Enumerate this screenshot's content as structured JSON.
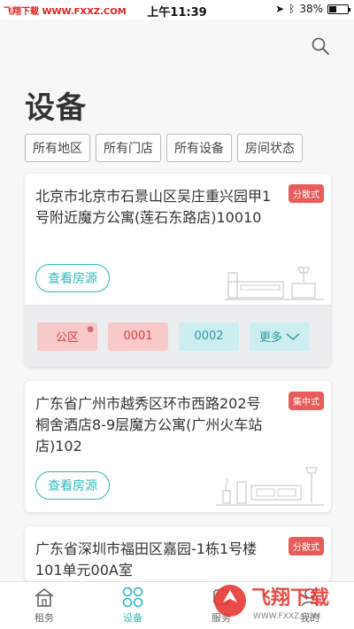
{
  "status_bar": {
    "carrier": "飞翔下载 WWW.FXXZ.COM",
    "time": "上午11:39",
    "battery": "38%"
  },
  "header": {
    "title": "设备",
    "search_icon": "search-icon"
  },
  "filters": [
    "所有地区",
    "所有门店",
    "所有设备",
    "房间状态"
  ],
  "cards": [
    {
      "address": "北京市北京市石景山区吴庄重兴园甲1号附近魔方公寓(莲石东路店)10010",
      "tag": "分散式",
      "view_button": "查看房源",
      "chips": [
        {
          "label": "公区",
          "style": "red"
        },
        {
          "label": "0001",
          "style": "red"
        },
        {
          "label": "0002",
          "style": "teal"
        },
        {
          "label": "更多",
          "style": "teal"
        }
      ]
    },
    {
      "address": "广东省广州市越秀区环市西路202号桐舍酒店8-9层魔方公寓(广州火车站店)102",
      "tag": "集中式",
      "view_button": "查看房源"
    },
    {
      "address": "广东省深圳市福田区嘉园-1栋1号楼101单元00A室",
      "tag": "分散式"
    }
  ],
  "tabbar": [
    {
      "label": "租务",
      "icon": "house-icon"
    },
    {
      "label": "设备",
      "icon": "circles-icon"
    },
    {
      "label": "服务",
      "icon": "service-icon"
    },
    {
      "label": "我的",
      "icon": "profile-icon"
    }
  ],
  "watermark": {
    "text": "飞翔下载",
    "url": "WWW.FXXZ.COM"
  },
  "colors": {
    "accent": "#2fb9b9",
    "tag": "#e85c5c"
  }
}
